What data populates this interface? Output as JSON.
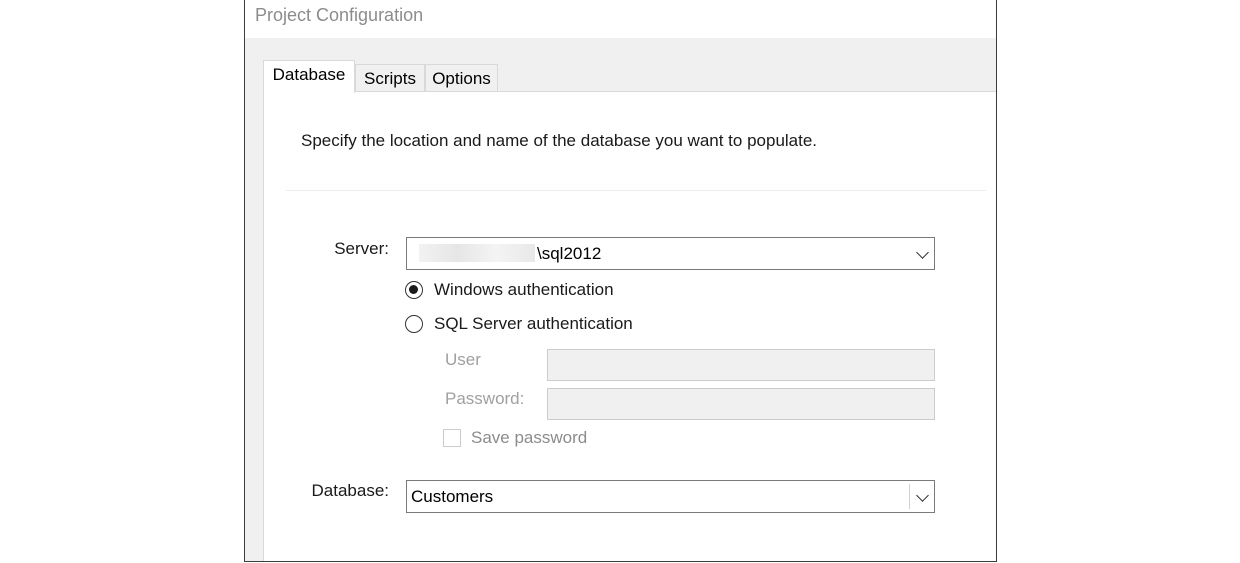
{
  "window": {
    "title": "Project Configuration"
  },
  "tabs": [
    {
      "label": "Database",
      "active": true
    },
    {
      "label": "Scripts",
      "active": false
    },
    {
      "label": "Options",
      "active": false
    }
  ],
  "panel": {
    "instruction": "Specify the location and name of the database you want to populate.",
    "server": {
      "label": "Server:",
      "value": "\\sql2012"
    },
    "auth": {
      "windows_label": "Windows authentication",
      "sql_label": "SQL Server authentication",
      "selected": "windows"
    },
    "user": {
      "label": "User",
      "value": ""
    },
    "password": {
      "label": "Password:",
      "value": ""
    },
    "save_password": {
      "label": "Save password",
      "checked": false
    },
    "database": {
      "label": "Database:",
      "value": "Customers"
    }
  }
}
